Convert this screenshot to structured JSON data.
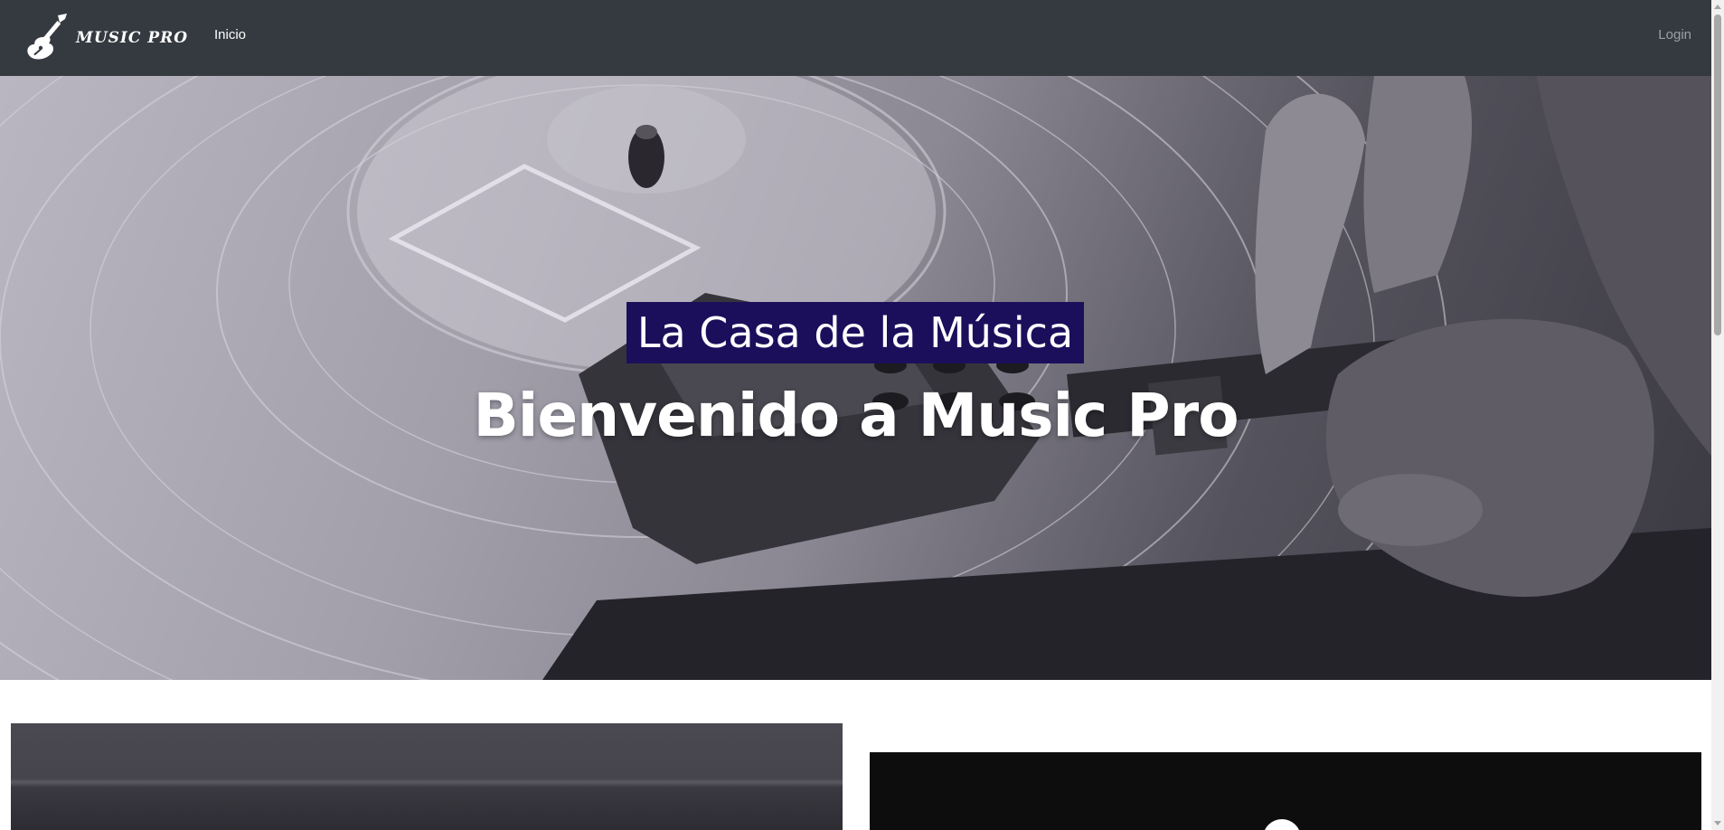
{
  "navbar": {
    "brand_text": "MUSIC PRO",
    "brand_icon": "guitar-icon",
    "links": {
      "inicio": "Inicio",
      "login": "Login"
    }
  },
  "hero": {
    "subtitle": "La Casa de la Música",
    "title": "Bienvenido a Music Pro"
  },
  "colors": {
    "navbar_bg": "#343a40",
    "subtitle_bg": "#1b0f5c",
    "text": "#ffffff",
    "login_link": "#9aa0a6"
  }
}
